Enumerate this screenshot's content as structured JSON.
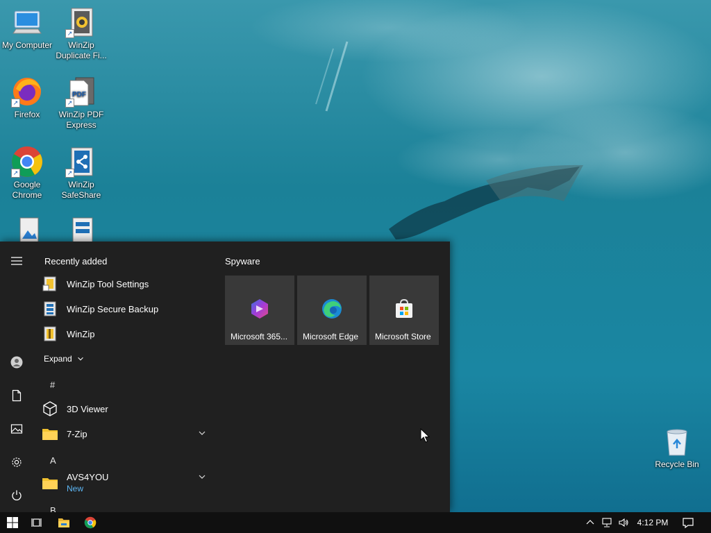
{
  "desktop": {
    "icons": [
      {
        "label": "My Computer",
        "icon": "computer-icon"
      },
      {
        "label": "WinZip Duplicate Fi...",
        "icon": "winzip-duplicate-icon"
      },
      {
        "label": "Firefox",
        "icon": "firefox-icon"
      },
      {
        "label": "WinZip PDF Express",
        "icon": "winzip-pdf-icon"
      },
      {
        "label": "Google Chrome",
        "icon": "chrome-icon"
      },
      {
        "label": "WinZip SafeShare",
        "icon": "winzip-safeshare-icon"
      },
      {
        "label": "Recycle Bin",
        "icon": "recycle-bin-icon"
      }
    ]
  },
  "start_menu": {
    "recently_added_title": "Recently added",
    "recent": [
      {
        "label": "WinZip Tool Settings",
        "icon": "winzip-tool-icon"
      },
      {
        "label": "WinZip Secure Backup",
        "icon": "winzip-backup-icon"
      },
      {
        "label": "WinZip",
        "icon": "winzip-icon"
      }
    ],
    "expand_label": "Expand",
    "letters": [
      "#",
      "A",
      "B"
    ],
    "apps": [
      {
        "label": "3D Viewer",
        "icon": "cube-icon"
      },
      {
        "label": "7-Zip",
        "icon": "folder-icon",
        "expandable": true
      },
      {
        "label": "AVS4YOU",
        "sub": "New",
        "icon": "folder-icon",
        "expandable": true
      }
    ],
    "tile_group_title": "Spyware",
    "tiles": [
      {
        "label": "Microsoft 365...",
        "icon": "microsoft-365-icon"
      },
      {
        "label": "Microsoft Edge",
        "icon": "edge-icon"
      },
      {
        "label": "Microsoft Store",
        "icon": "store-icon"
      }
    ]
  },
  "taskbar": {
    "clock": "4:12 PM",
    "pinned": [
      "windows-start-icon",
      "task-view-icon",
      "file-explorer-icon",
      "chrome-icon"
    ],
    "tray": [
      "chevron-up-icon",
      "network-icon",
      "volume-icon",
      "notification-icon"
    ]
  },
  "colors": {
    "start_bg": "#202020",
    "tile_bg": "#393939",
    "taskbar_bg": "#101010",
    "accent_new": "#5db7f5"
  }
}
